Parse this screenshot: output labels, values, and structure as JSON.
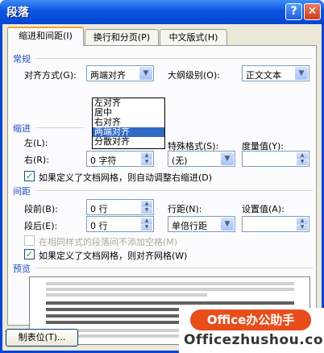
{
  "window": {
    "title": "段落",
    "help": "?",
    "close": "✕"
  },
  "tabs": [
    {
      "label": "缩进和间距(I)"
    },
    {
      "label": "换行和分页(P)"
    },
    {
      "label": "中文版式(H)"
    }
  ],
  "general": {
    "header": "常规",
    "alignment_label": "对齐方式(G):",
    "alignment_value": "两端对齐",
    "outline_label": "大纲级别(O):",
    "outline_value": "正文文本",
    "alignment_options": [
      "左对齐",
      "居中",
      "右对齐",
      "两端对齐",
      "分散对齐"
    ],
    "selected_option": "两端对齐"
  },
  "indent": {
    "header": "缩进",
    "left_label": "左(L):",
    "right_label": "右(R):",
    "right_value": "0 字符",
    "special_label": "特殊格式(S):",
    "special_value": "(无)",
    "by_label": "度量值(Y):",
    "auto_adjust_label": "如果定义了文档网格，则自动调整右缩进(D)",
    "auto_adjust_checked": true
  },
  "spacing": {
    "header": "间距",
    "before_label": "段前(B):",
    "before_value": "0 行",
    "after_label": "段后(E):",
    "after_value": "0 行",
    "line_label": "行距(N):",
    "line_value": "单倍行距",
    "at_label": "设置值(A):",
    "no_space_label": "在相同样式的段落间不添加空格(M)",
    "no_space_checked": false,
    "snap_label": "如果定义了文档网格，则对齐网格(W)",
    "snap_checked": true
  },
  "preview": {
    "header": "预览"
  },
  "buttons": {
    "tabs": "制表位(T)..."
  },
  "watermark": {
    "line1": "Office办公助手",
    "line2": "Officezhushou.com"
  },
  "check_mark": "✓"
}
